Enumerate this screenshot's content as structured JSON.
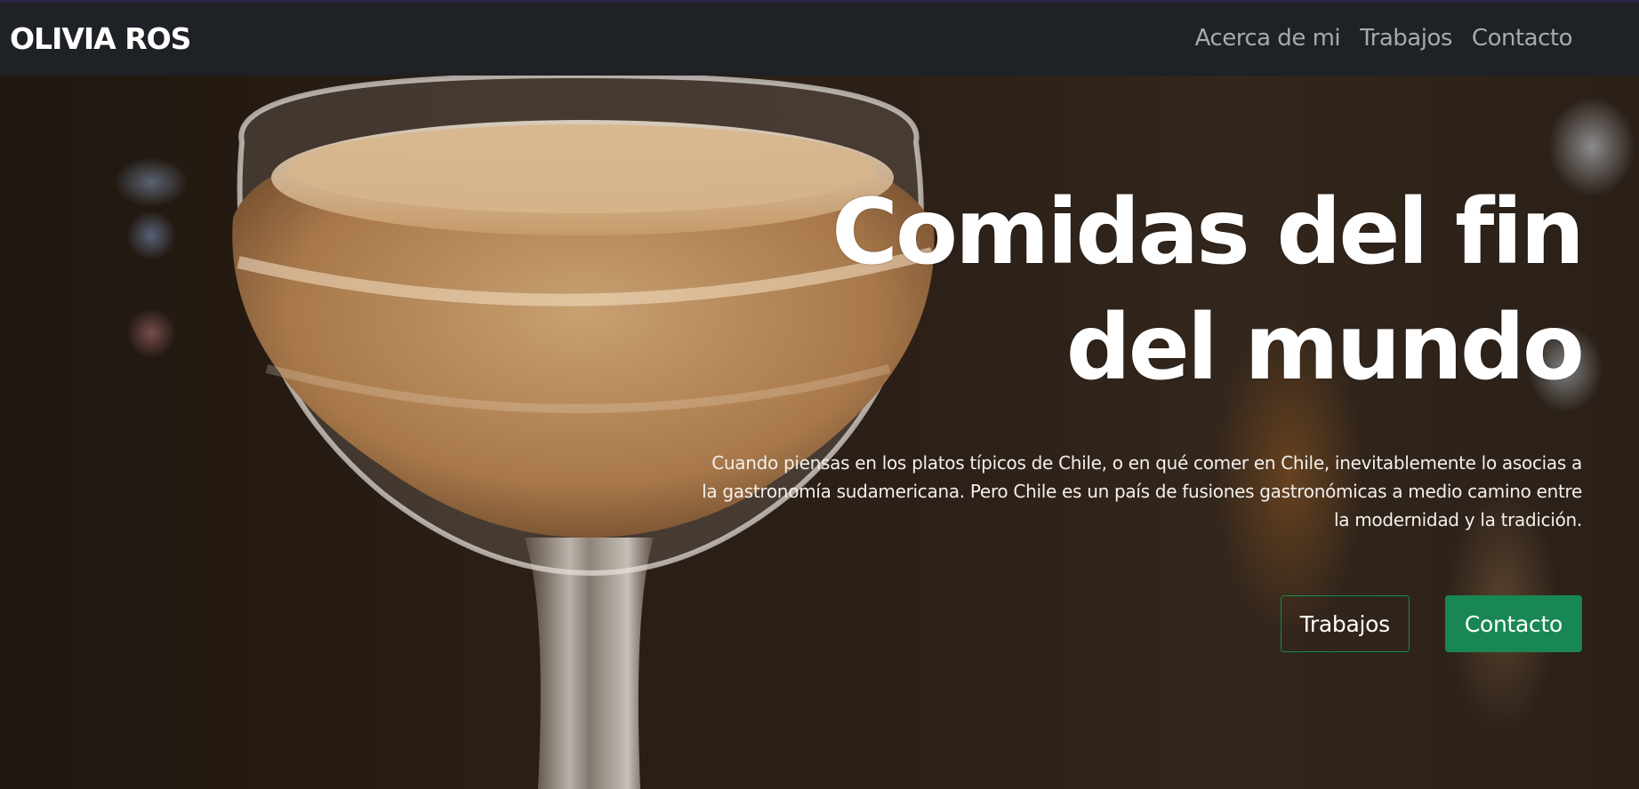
{
  "navbar": {
    "brand": "OLIVIA ROS",
    "links": [
      "Acerca de mi",
      "Trabajos",
      "Contacto"
    ]
  },
  "hero": {
    "title_line1": "Comidas del fin",
    "title_line2": "del mundo",
    "description_line1": "Cuando piensas en los platos típicos de Chile, o en qué comer en Chile, inevitablemente lo asocias a",
    "description_line2": "la gastronomía sudamericana. Pero Chile es un país de fusiones gastronómicas a medio camino entre",
    "description_line3": "la modernidad y la tradición.",
    "primary_button": "Trabajos",
    "secondary_button": "Contacto"
  },
  "colors": {
    "navbar_bg": "#1e2126",
    "accent_green": "#198754",
    "nav_link": "#a7a9ad"
  }
}
